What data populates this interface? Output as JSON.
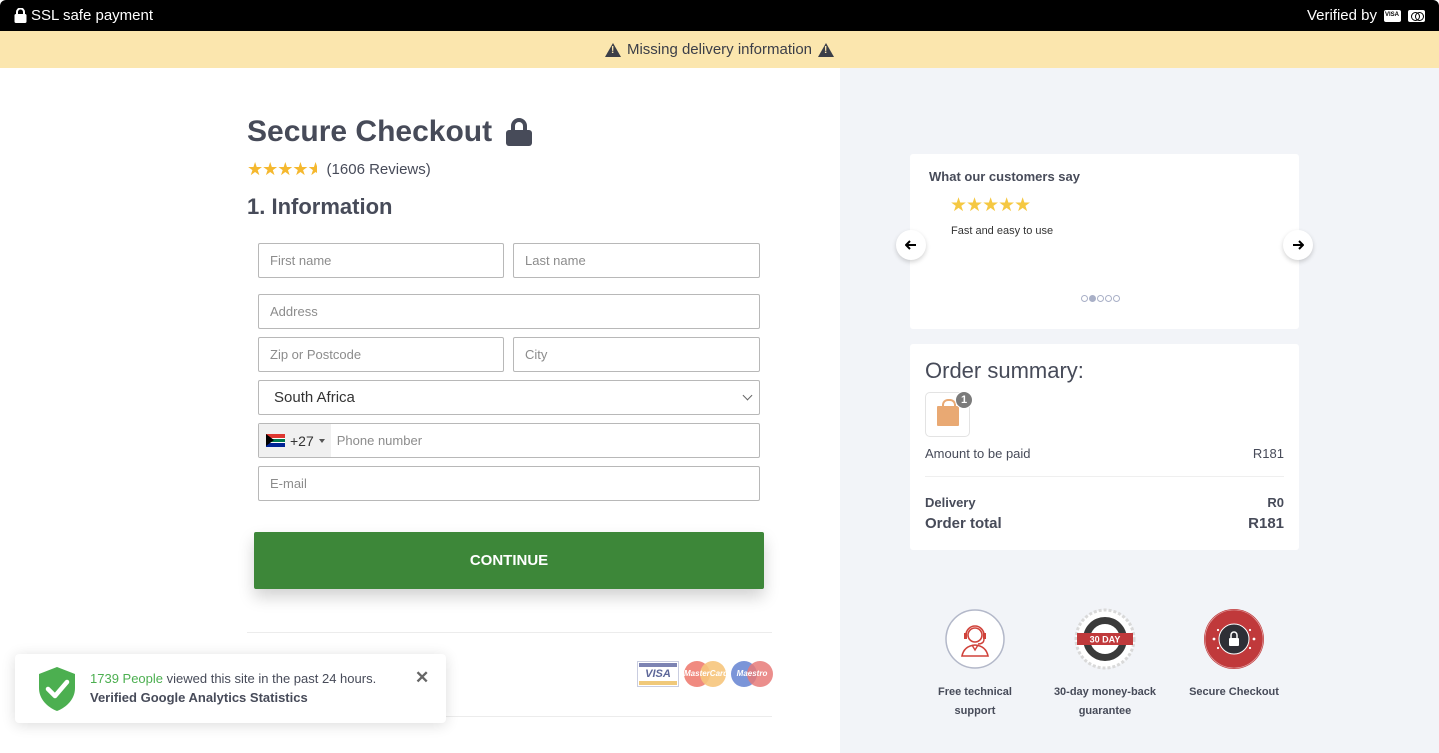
{
  "topbar": {
    "ssl_label": "SSL safe payment",
    "verified_label": "Verified by",
    "verified_cards": [
      "visa-icon",
      "mastercard-icon"
    ]
  },
  "warning": {
    "text": "Missing delivery information"
  },
  "checkout": {
    "title": "Secure Checkout",
    "rating_stars": 4.5,
    "rating_max": 5,
    "reviews_label": "(1606 Reviews)",
    "section_title": "1. Information",
    "fields": {
      "first_name": {
        "placeholder": "First name",
        "value": ""
      },
      "last_name": {
        "placeholder": "Last name",
        "value": ""
      },
      "address": {
        "placeholder": "Address",
        "value": ""
      },
      "zip": {
        "placeholder": "Zip or Postcode",
        "value": ""
      },
      "city": {
        "placeholder": "City",
        "value": ""
      },
      "country": {
        "selected": "South Africa"
      },
      "phone": {
        "dial_code": "+27",
        "flag": "south-africa-flag-icon",
        "placeholder": "Phone number",
        "value": ""
      },
      "email": {
        "placeholder": "E-mail",
        "value": ""
      }
    },
    "continue_label": "CONTINUE",
    "payment_logos": {
      "visa": "VISA",
      "mastercard": "MasterCard",
      "maestro": "Maestro"
    }
  },
  "toast": {
    "count_text": "1739 People",
    "rest_text": " viewed this site in the past 24 hours.",
    "subtitle": "Verified Google Analytics Statistics",
    "close_glyph": "✕"
  },
  "testimonial": {
    "heading": "What our customers say",
    "stars": 5,
    "quote": "Fast and easy to use",
    "active_dot": 1,
    "dot_count": 5,
    "prev_glyph": "🡐",
    "next_glyph": "🡒"
  },
  "summary": {
    "heading": "Order summary:",
    "item_count": "1",
    "amount_label": "Amount to be paid",
    "amount_value": "R181",
    "delivery_label": "Delivery",
    "delivery_value": "R0",
    "total_label": "Order total",
    "total_value": "R181"
  },
  "trust_badges": [
    {
      "label": "Free technical support",
      "icon": "headset-support-icon"
    },
    {
      "label": "30-day money-back guarantee",
      "icon": "30-day-badge-icon",
      "badge_text": "30 DAY"
    },
    {
      "label": "Secure Checkout",
      "icon": "secure-checkout-seal-icon"
    }
  ],
  "colors": {
    "accent_green": "#3d8739",
    "warning_bg": "#fbe6ae",
    "star_yellow": "#f5b82e",
    "highlight_green": "#4caf50"
  }
}
